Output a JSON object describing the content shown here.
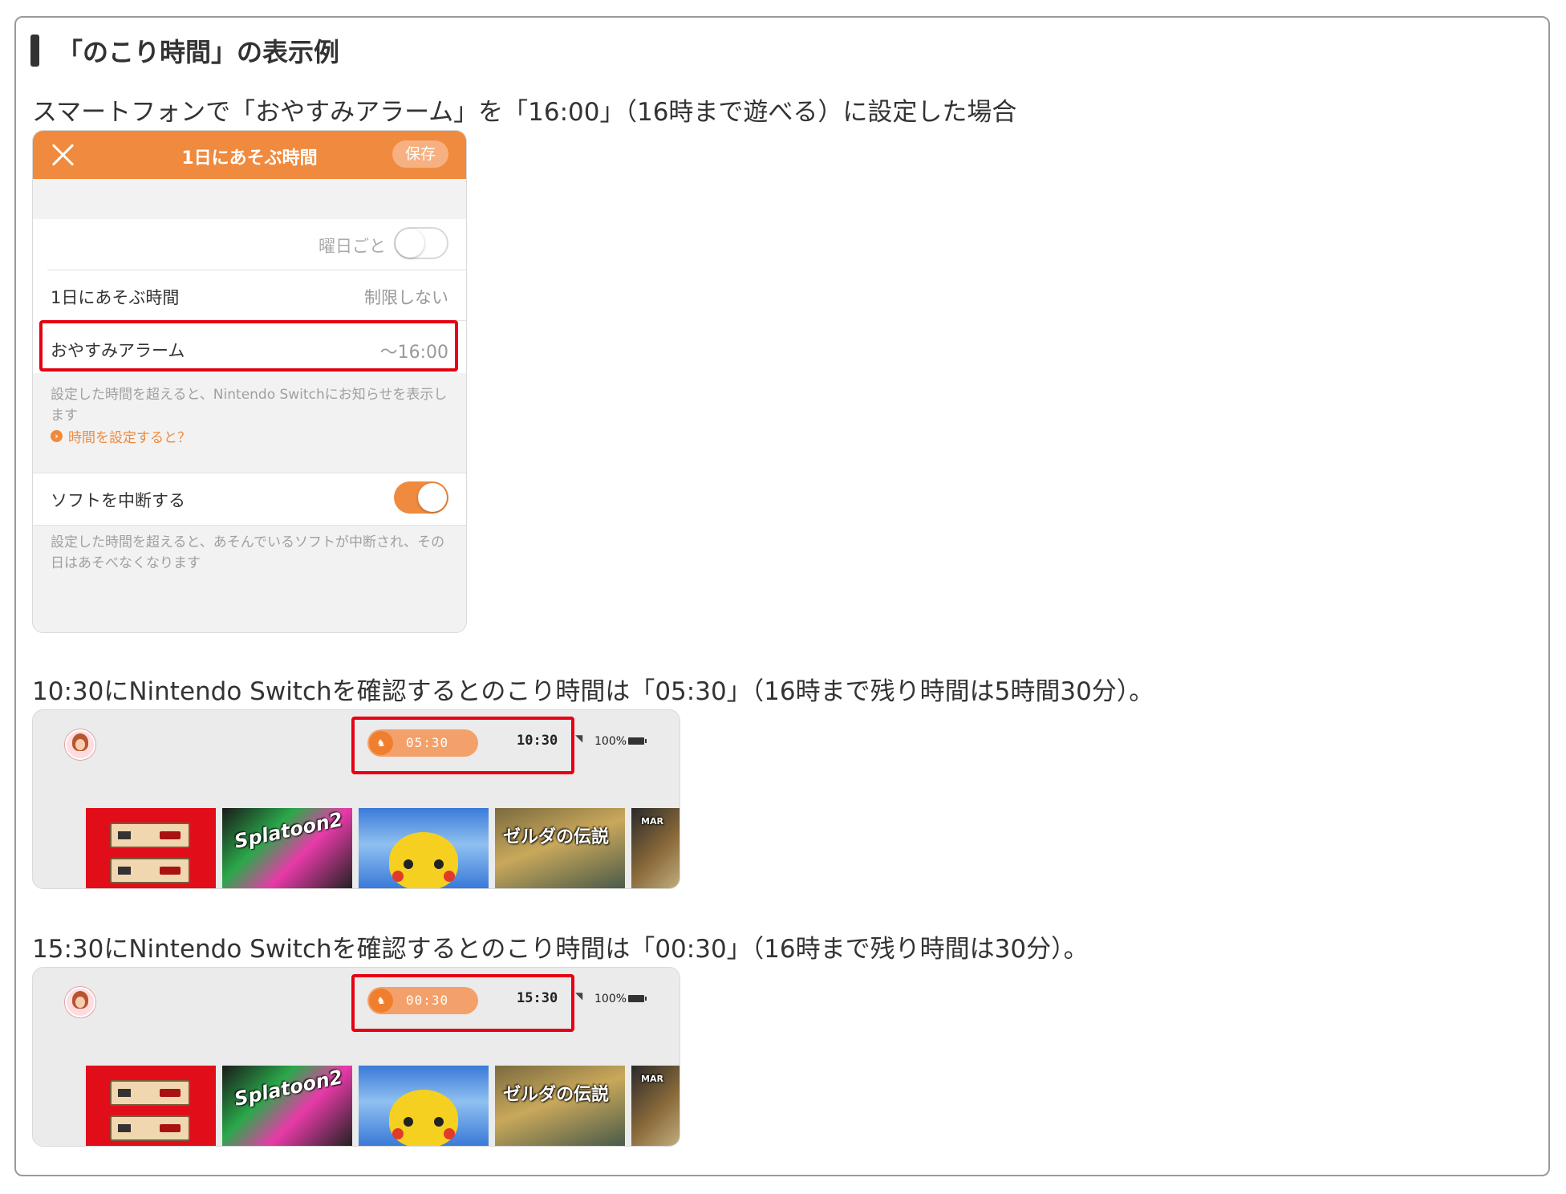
{
  "heading": "「のこり時間」の表示例",
  "captions": {
    "first": "スマートフォンで「おやすみアラーム」を「16:00」（16時まで遊べる）に設定した場合",
    "second": "10:30にNintendo Switchを確認するとのこり時間は「05:30」（16時まで残り時間は5時間30分）。",
    "third": "15:30にNintendo Switchを確認するとのこり時間は「00:30」（16時まで残り時間は30分）。"
  },
  "phone": {
    "title": "1日にあそぶ時間",
    "save_label": "保存",
    "per_day_label": "曜日ごと",
    "per_day_toggle": false,
    "daily_time_label": "1日にあそぶ時間",
    "daily_time_value": "制限しない",
    "alarm_label": "おやすみアラーム",
    "alarm_value": "〜16:00",
    "alarm_note": "設定した時間を超えると、Nintendo Switchにお知らせを表示します",
    "alarm_link": "時間を設定すると？",
    "suspend_label": "ソフトを中断する",
    "suspend_toggle": true,
    "suspend_note": "設定した時間を超えると、あそんでいるソフトが中断され、その日はあそべなくなります"
  },
  "switch_screens": [
    {
      "remaining": "05:30",
      "clock": "10:30",
      "battery": "100%"
    },
    {
      "remaining": "00:30",
      "clock": "15:30",
      "battery": "100%"
    }
  ],
  "tiles": {
    "splatoon": "Splatoon2",
    "zelda": "ゼルダの伝説",
    "mario": "MAR"
  },
  "colors": {
    "accent_orange": "#ef8a3e",
    "highlight_red": "#e60012"
  }
}
